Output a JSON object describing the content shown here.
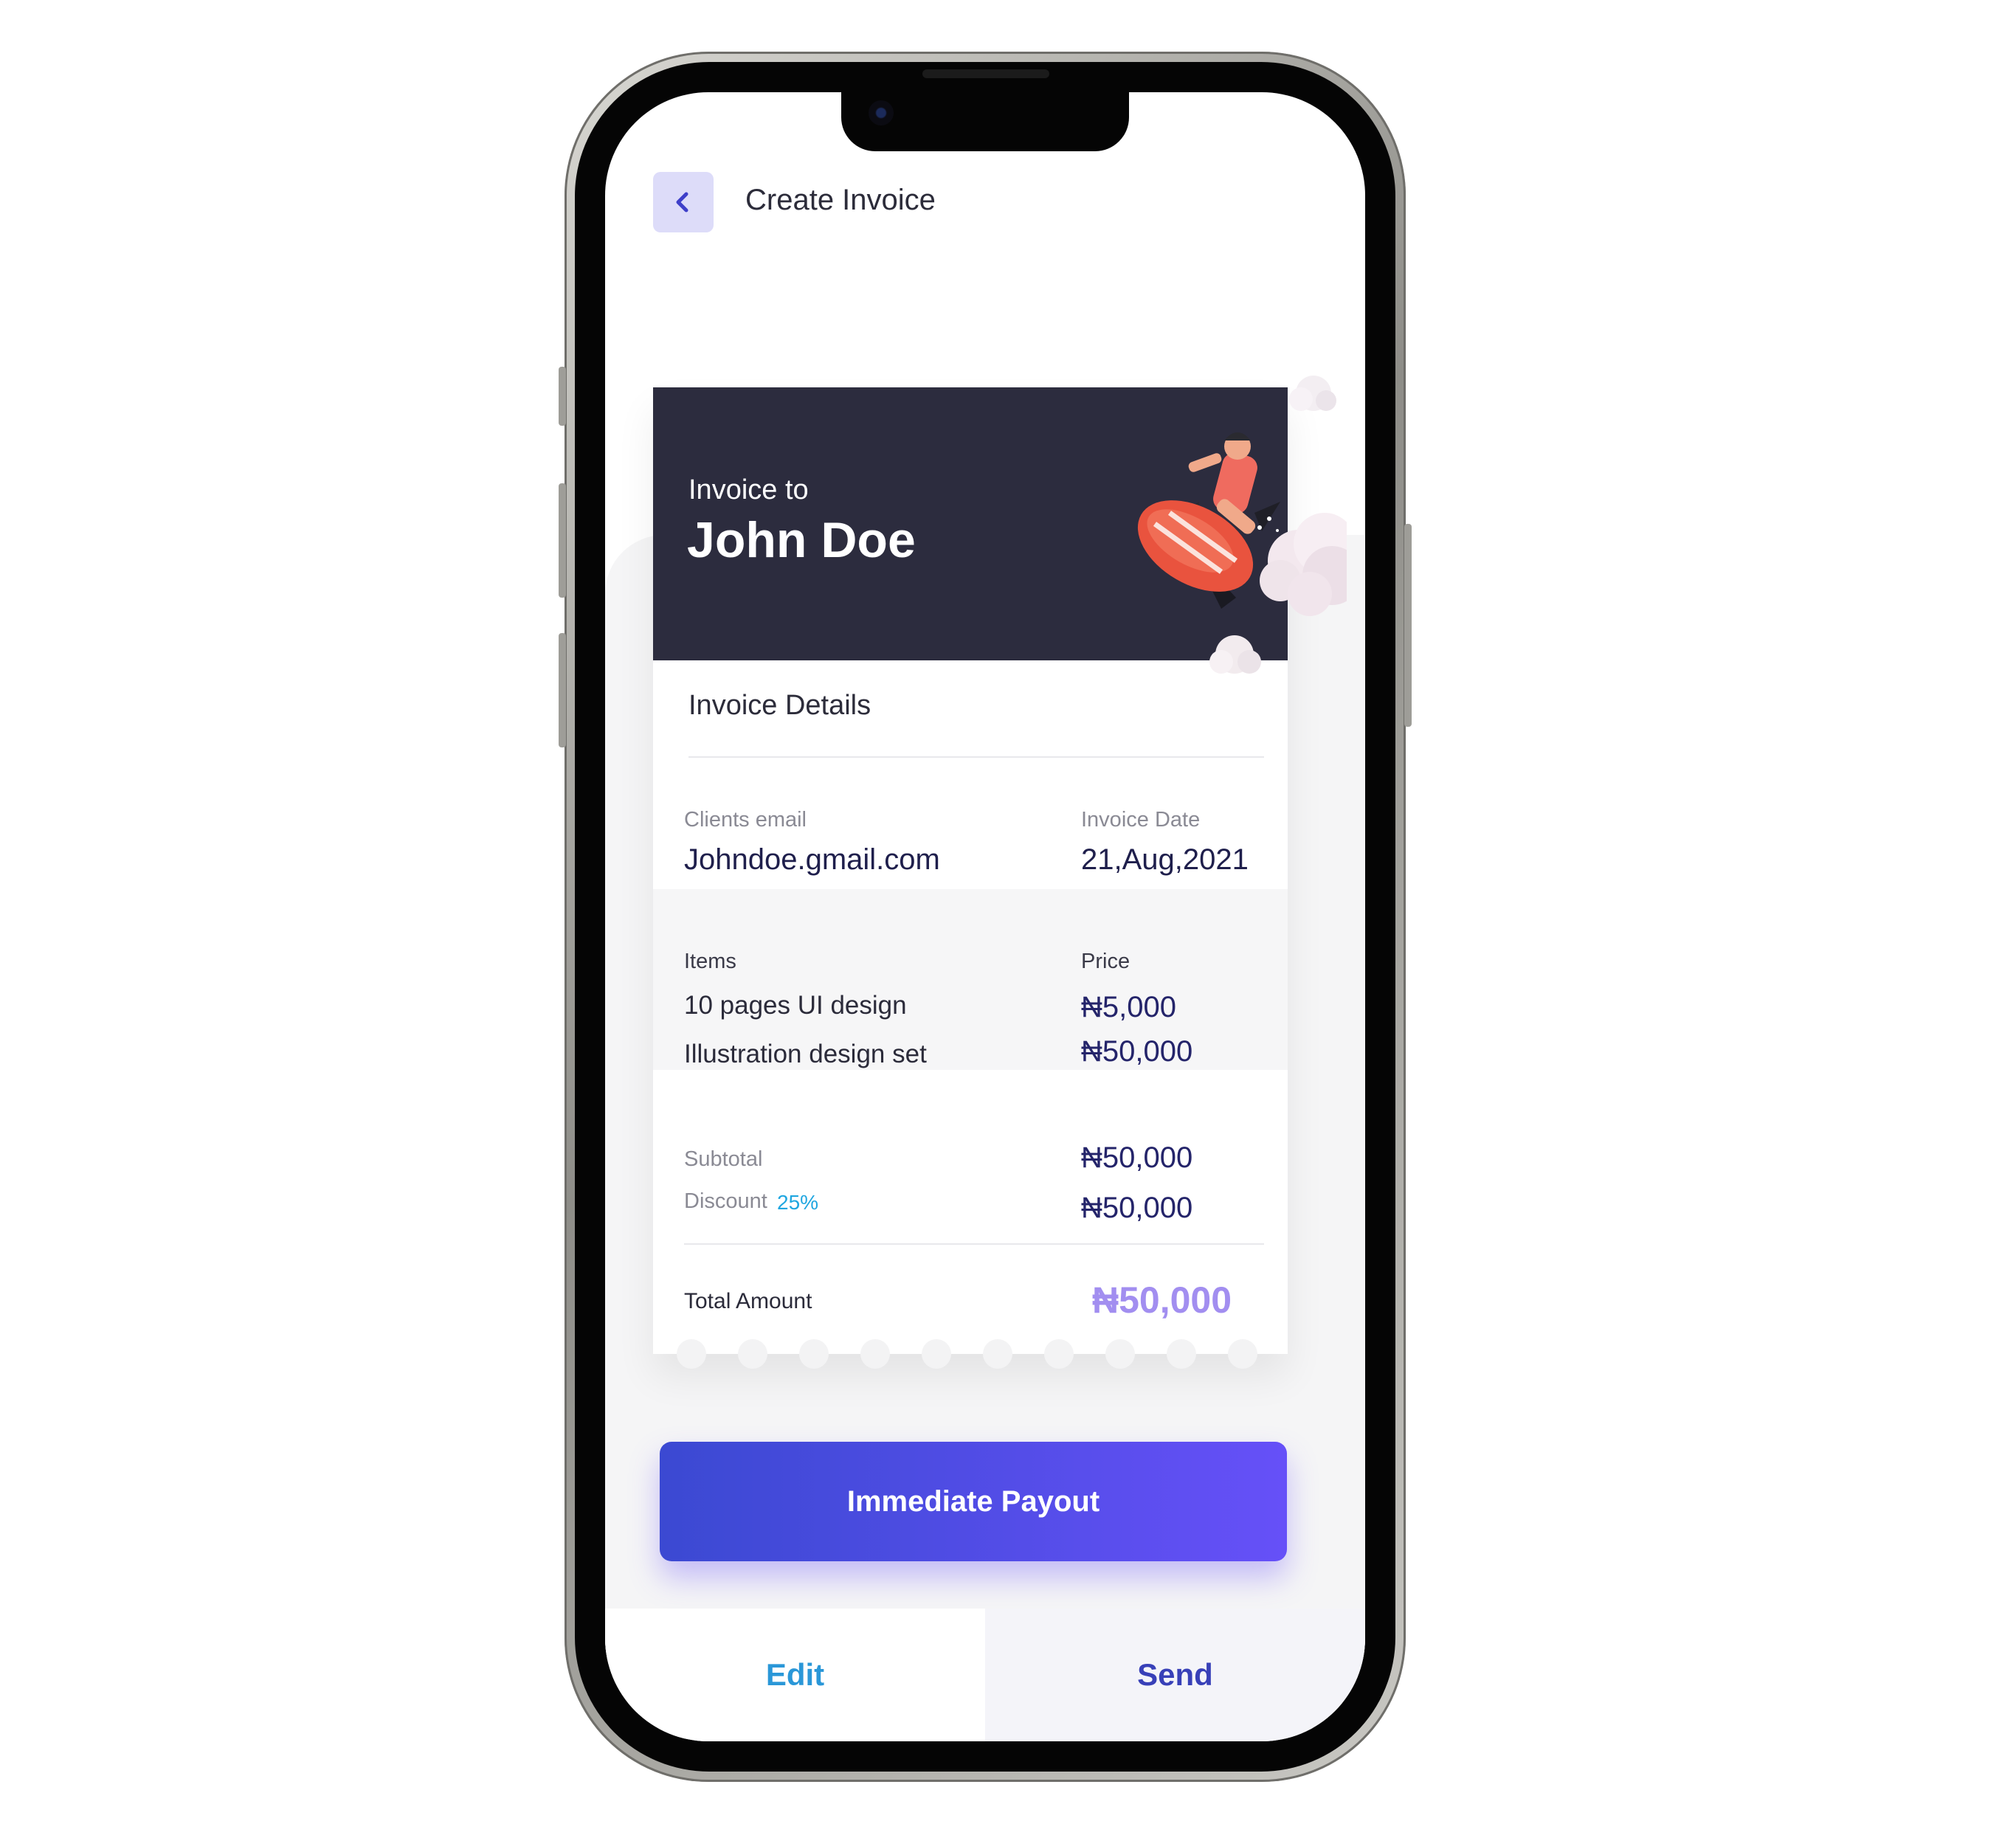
{
  "header": {
    "title": "Create Invoice"
  },
  "invoice": {
    "to_label": "Invoice to",
    "name": "John Doe",
    "details_title": "Invoice Details",
    "email_label": "Clients email",
    "email": "Johndoe.gmail.com",
    "date_label": "Invoice Date",
    "date": "21,Aug,2021",
    "items_header": "Items",
    "price_header": "Price",
    "items": [
      {
        "name": "10 pages UI design",
        "price": "₦5,000"
      },
      {
        "name": "Illustration design set",
        "price": "₦50,000"
      }
    ],
    "subtotal_label": "Subtotal",
    "subtotal": "₦50,000",
    "discount_label": "Discount",
    "discount_pct": "25%",
    "discount": "₦50,000",
    "total_label": "Total Amount",
    "total": "₦50,000"
  },
  "actions": {
    "payout_label": "Immediate Payout",
    "edit_label": "Edit",
    "send_label": "Send"
  },
  "colors": {
    "accent": "#5a4cf0",
    "header_bg": "#2c2c3e",
    "edit": "#2a97d8",
    "send": "#3840b8",
    "total": "#a28ef0"
  },
  "icons": {
    "back": "chevron-left-icon",
    "illustration": "rocket-rider-illustration"
  }
}
